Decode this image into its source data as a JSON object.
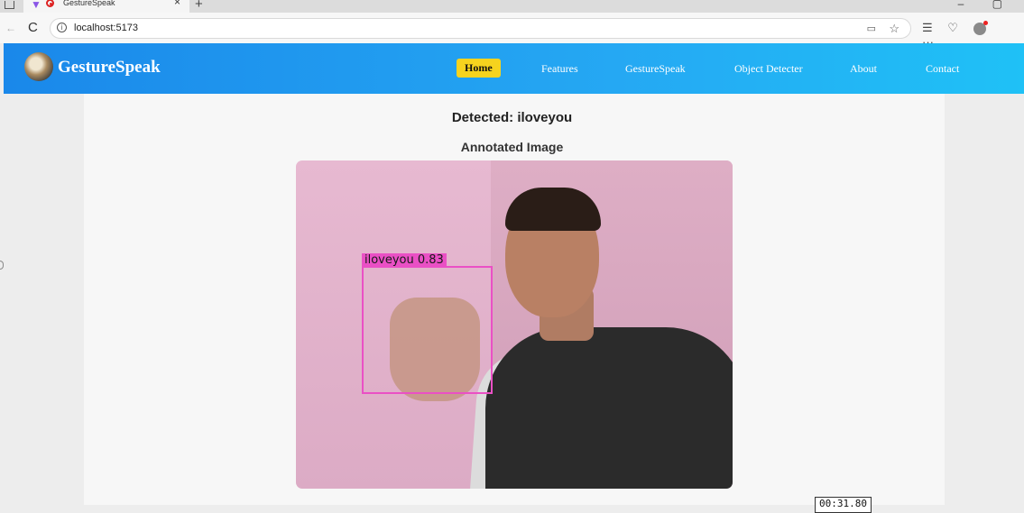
{
  "browser": {
    "tab_title": "GestureSpeak",
    "tab_close": "×",
    "new_tab": "+",
    "url": "localhost:5173",
    "window_controls": {
      "minimize": "–",
      "restore": "▢"
    },
    "toolbar_glyphs": {
      "back": "←",
      "reload": "C",
      "info": "i",
      "read_aloud": "▭",
      "favorite": "☆",
      "favorites": "☰",
      "health": "♡",
      "more": "···"
    }
  },
  "app": {
    "brand": "GestureSpeak",
    "nav": [
      "Home",
      "Features",
      "GestureSpeak",
      "Object Detecter",
      "About",
      "Contact"
    ],
    "active_nav": "Home",
    "accent_color": "#f6d31e",
    "header_gradient": [
      "#1a88ea",
      "#1fc1f6"
    ]
  },
  "result": {
    "detected": "Detected: iloveyou",
    "image_heading": "Annotated Image",
    "box_label": "iloveyou  0.83",
    "box_color": "#ea50c5"
  },
  "overlay": {
    "timer": "00:31.80"
  }
}
